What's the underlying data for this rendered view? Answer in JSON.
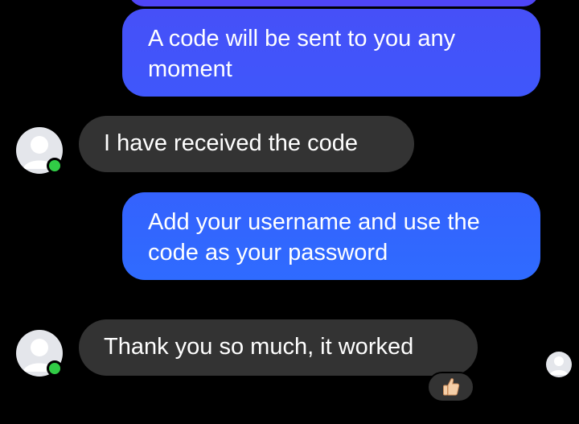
{
  "colors": {
    "background": "#000000",
    "outgoing_top": "#4650f8",
    "outgoing_bottom": "#2f6bff",
    "incoming": "#333333",
    "online": "#31cc46",
    "avatar_bg": "#e4e6eb",
    "avatar_fg": "#ffffff"
  },
  "messages": [
    {
      "direction": "outgoing",
      "text": "A code will be sent to you any moment"
    },
    {
      "direction": "incoming",
      "text": "I have received the code"
    },
    {
      "direction": "outgoing",
      "text": "Add your username and use the code as your password"
    },
    {
      "direction": "incoming",
      "text": "Thank you so much, it worked",
      "reaction": "thumbs-up-icon"
    }
  ],
  "icons": {
    "avatar": "default-user-avatar-icon",
    "online": "online-status-dot",
    "reaction": "thumbs-up-icon",
    "seen": "seen-receipt-avatar-icon"
  }
}
